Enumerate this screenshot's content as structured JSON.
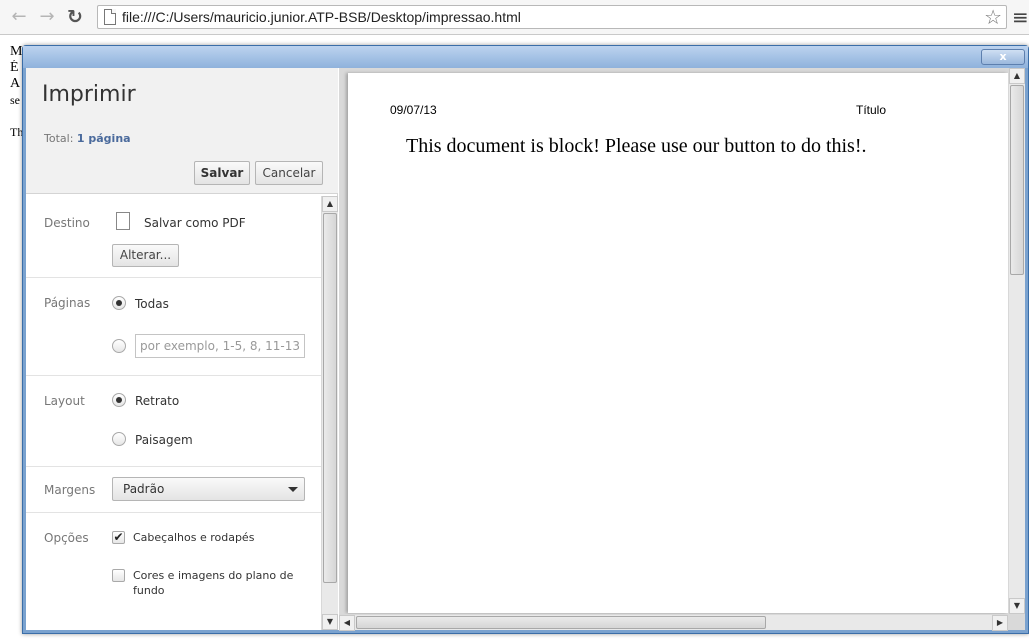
{
  "browser": {
    "url": "file:///C:/Users/mauricio.junior.ATP-BSB/Desktop/impressao.html"
  },
  "background_page": {
    "lines": [
      "M",
      "É",
      "A",
      "se",
      "",
      "Th"
    ]
  },
  "dialog": {
    "close_label": "x",
    "title": "Imprimir",
    "total_prefix": "Total:",
    "total_value": "1 página",
    "save_label": "Salvar",
    "cancel_label": "Cancelar",
    "destination": {
      "label": "Destino",
      "value": "Salvar como PDF",
      "change_label": "Alterar..."
    },
    "pages": {
      "label": "Páginas",
      "all_label": "Todas",
      "all_selected": true,
      "range_placeholder": "por exemplo, 1-5, 8, 11-13"
    },
    "layout": {
      "label": "Layout",
      "portrait_label": "Retrato",
      "landscape_label": "Paisagem",
      "selected": "Retrato"
    },
    "margins": {
      "label": "Margens",
      "value": "Padrão"
    },
    "options": {
      "label": "Opções",
      "headers_footers_label": "Cabeçalhos e rodapés",
      "headers_footers_checked": true,
      "background_label_line1": "Cores e imagens do plano de",
      "background_label_line2": "fundo",
      "background_checked": false
    }
  },
  "preview": {
    "header_date": "09/07/13",
    "header_title": "Título",
    "body_text": "This document is block! Please use our button to do this!."
  }
}
